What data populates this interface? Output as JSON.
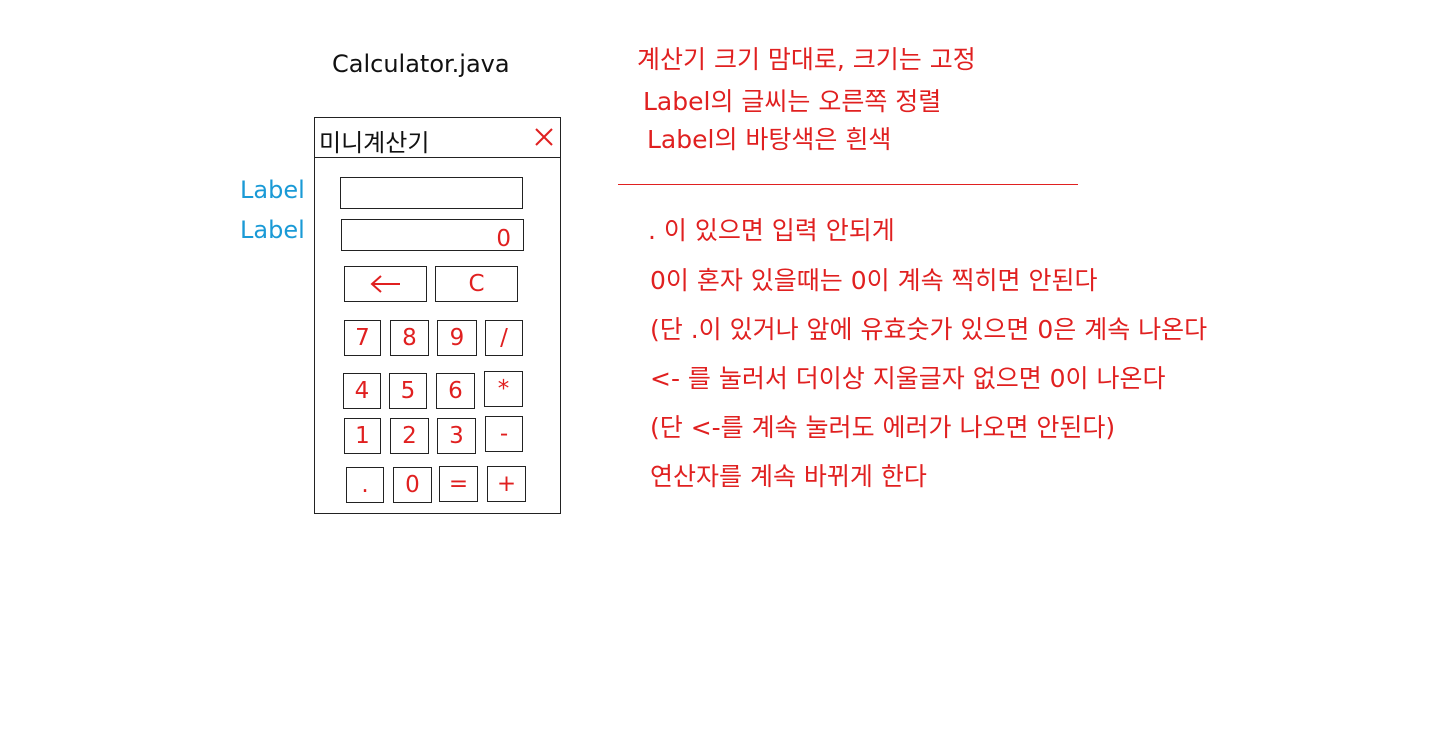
{
  "file_title": "Calculator.java",
  "window": {
    "title": "미니계산기"
  },
  "side_labels": [
    "Label",
    "Label"
  ],
  "fields": {
    "field1_value": "",
    "field2_value": "0"
  },
  "top_buttons": {
    "back_icon": "left-arrow-icon",
    "clear_label": "C"
  },
  "keypad": [
    [
      "7",
      "8",
      "9",
      "/"
    ],
    [
      "4",
      "5",
      "6",
      "*"
    ],
    [
      "1",
      "2",
      "3",
      "-"
    ],
    [
      ".",
      "0",
      "=",
      "+"
    ]
  ],
  "notes_top": [
    "계산기 크기 맘대로, 크기는 고정",
    "Label의 글씨는 오른쪽 정렬",
    "Label의 바탕색은 흰색"
  ],
  "notes_bottom": [
    ". 이 있으면 입력 안되게",
    "0이 혼자 있을때는 0이 계속 찍히면 안된다",
    "(단 .이 있거나 앞에 유효숫가 있으면 0은 계속 나온다",
    "<- 를 눌러서 더이상 지울글자 없으면 0이 나온다",
    "(단 <-를 계속 눌러도 에러가 나오면 안된다)",
    "연산자를 계속 바뀌게 한다"
  ],
  "colors": {
    "annotation": "#e02020",
    "label_blue": "#1a9ad6",
    "outline": "#222222"
  }
}
